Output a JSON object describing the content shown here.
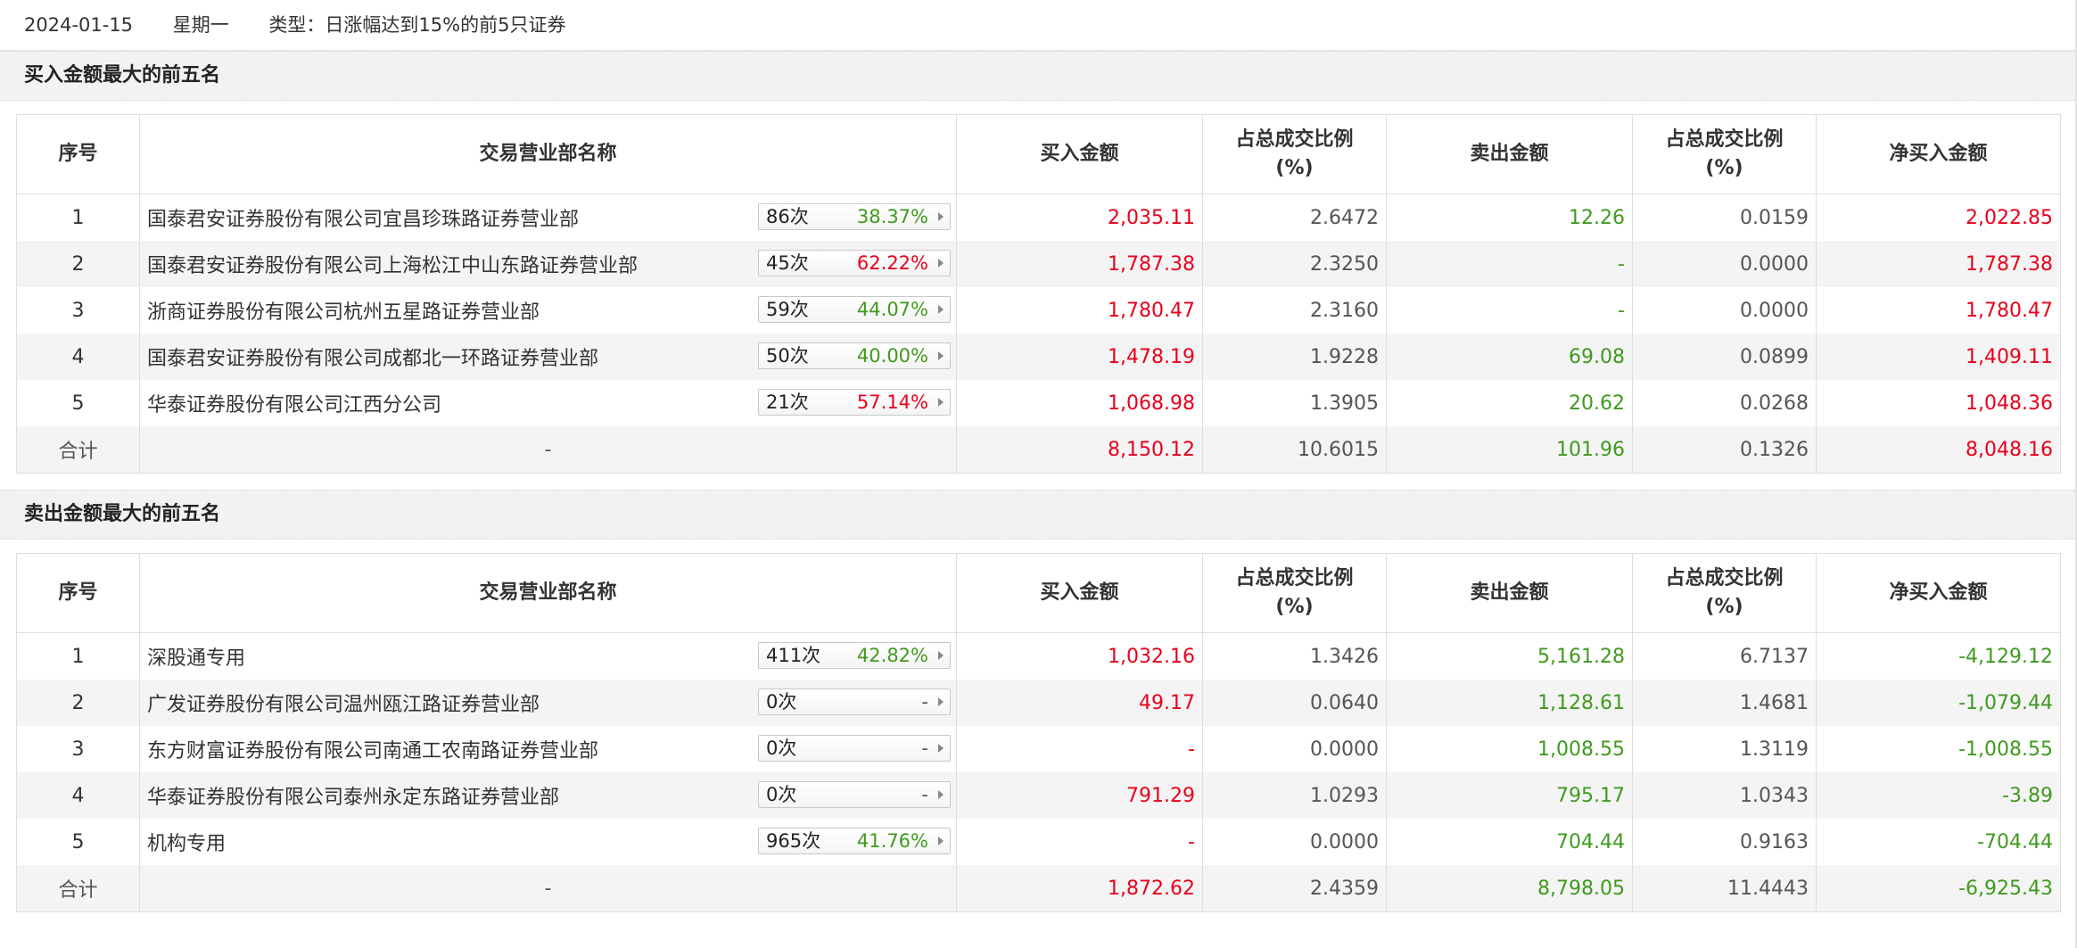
{
  "header": {
    "date": "2024-01-15",
    "weekday": "星期一",
    "type": "类型：日涨幅达到15%的前5只证券"
  },
  "columns": {
    "seq": "序号",
    "name": "交易营业部名称",
    "buy": "买入金额",
    "buy_ratio": "占总成交比例",
    "sell": "卖出金额",
    "sell_ratio": "占总成交比例",
    "pct_unit": "(%)",
    "net": "净买入金额"
  },
  "sections": [
    {
      "title": "买入金额最大的前五名",
      "rows": [
        {
          "seq": "1",
          "name": "国泰君安证券股份有限公司宜昌珍珠路证券营业部",
          "count": "86次",
          "pct": "38.37%",
          "pct_color": "green",
          "buy": "2,035.11",
          "buy_ratio": "2.6472",
          "sell": "12.26",
          "sell_ratio": "0.0159",
          "net": "2,022.85",
          "net_color": "red",
          "buy_color": "red",
          "sell_color": "green"
        },
        {
          "seq": "2",
          "name": "国泰君安证券股份有限公司上海松江中山东路证券营业部",
          "count": "45次",
          "pct": "62.22%",
          "pct_color": "red",
          "buy": "1,787.38",
          "buy_ratio": "2.3250",
          "sell": "-",
          "sell_ratio": "0.0000",
          "net": "1,787.38",
          "net_color": "red",
          "buy_color": "red",
          "sell_color": "green"
        },
        {
          "seq": "3",
          "name": "浙商证券股份有限公司杭州五星路证券营业部",
          "count": "59次",
          "pct": "44.07%",
          "pct_color": "green",
          "buy": "1,780.47",
          "buy_ratio": "2.3160",
          "sell": "-",
          "sell_ratio": "0.0000",
          "net": "1,780.47",
          "net_color": "red",
          "buy_color": "red",
          "sell_color": "green"
        },
        {
          "seq": "4",
          "name": "国泰君安证券股份有限公司成都北一环路证券营业部",
          "count": "50次",
          "pct": "40.00%",
          "pct_color": "green",
          "buy": "1,478.19",
          "buy_ratio": "1.9228",
          "sell": "69.08",
          "sell_ratio": "0.0899",
          "net": "1,409.11",
          "net_color": "red",
          "buy_color": "red",
          "sell_color": "green"
        },
        {
          "seq": "5",
          "name": "华泰证券股份有限公司江西分公司",
          "count": "21次",
          "pct": "57.14%",
          "pct_color": "red",
          "buy": "1,068.98",
          "buy_ratio": "1.3905",
          "sell": "20.62",
          "sell_ratio": "0.0268",
          "net": "1,048.36",
          "net_color": "red",
          "buy_color": "red",
          "sell_color": "green"
        }
      ],
      "total": {
        "label": "合计",
        "name": "-",
        "buy": "8,150.12",
        "buy_ratio": "10.6015",
        "sell": "101.96",
        "sell_ratio": "0.1326",
        "net": "8,048.16",
        "net_color": "red"
      }
    },
    {
      "title": "卖出金额最大的前五名",
      "rows": [
        {
          "seq": "1",
          "name": "深股通专用",
          "count": "411次",
          "pct": "42.82%",
          "pct_color": "green",
          "buy": "1,032.16",
          "buy_ratio": "1.3426",
          "sell": "5,161.28",
          "sell_ratio": "6.7137",
          "net": "-4,129.12",
          "net_color": "green",
          "buy_color": "red",
          "sell_color": "green"
        },
        {
          "seq": "2",
          "name": "广发证券股份有限公司温州瓯江路证券营业部",
          "count": "0次",
          "pct": "-",
          "pct_color": "dark",
          "buy": "49.17",
          "buy_ratio": "0.0640",
          "sell": "1,128.61",
          "sell_ratio": "1.4681",
          "net": "-1,079.44",
          "net_color": "green",
          "buy_color": "red",
          "sell_color": "green"
        },
        {
          "seq": "3",
          "name": "东方财富证券股份有限公司南通工农南路证券营业部",
          "count": "0次",
          "pct": "-",
          "pct_color": "dark",
          "buy": "-",
          "buy_ratio": "0.0000",
          "sell": "1,008.55",
          "sell_ratio": "1.3119",
          "net": "-1,008.55",
          "net_color": "green",
          "buy_color": "red",
          "sell_color": "green"
        },
        {
          "seq": "4",
          "name": "华泰证券股份有限公司泰州永定东路证券营业部",
          "count": "0次",
          "pct": "-",
          "pct_color": "dark",
          "buy": "791.29",
          "buy_ratio": "1.0293",
          "sell": "795.17",
          "sell_ratio": "1.0343",
          "net": "-3.89",
          "net_color": "green",
          "buy_color": "red",
          "sell_color": "green"
        },
        {
          "seq": "5",
          "name": "机构专用",
          "count": "965次",
          "pct": "41.76%",
          "pct_color": "green",
          "buy": "-",
          "buy_ratio": "0.0000",
          "sell": "704.44",
          "sell_ratio": "0.9163",
          "net": "-704.44",
          "net_color": "green",
          "buy_color": "red",
          "sell_color": "green"
        }
      ],
      "total": {
        "label": "合计",
        "name": "-",
        "buy": "1,872.62",
        "buy_ratio": "2.4359",
        "sell": "8,798.05",
        "sell_ratio": "11.4443",
        "net": "-6,925.43",
        "net_color": "green"
      }
    }
  ],
  "colors": {
    "red": "#e8001c",
    "green": "#3f9a1e",
    "header_bg": "#f2f2f2"
  }
}
